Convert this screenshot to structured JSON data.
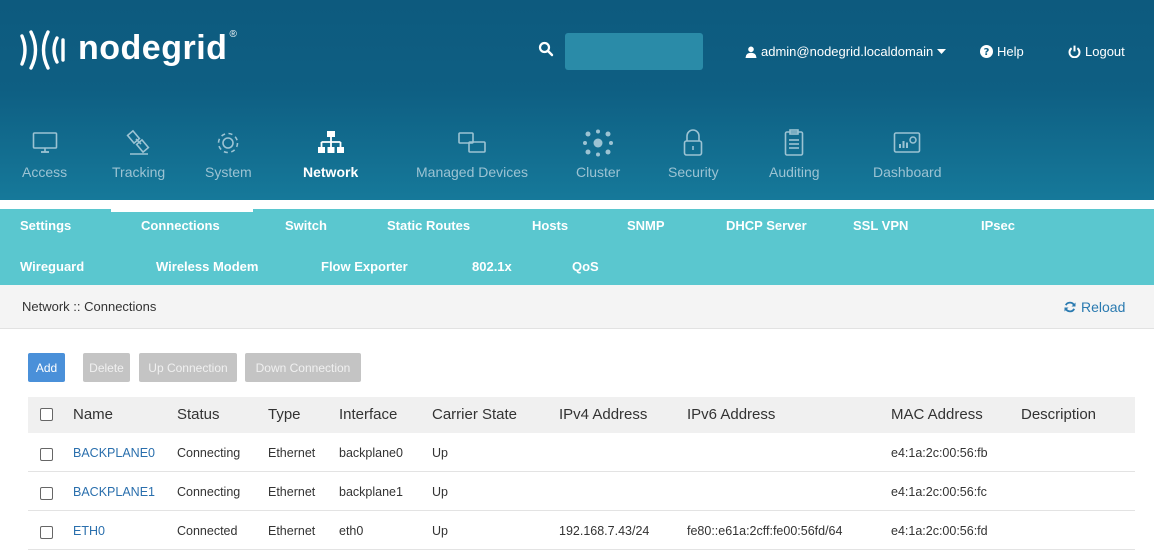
{
  "header": {
    "logo_text": "nodegrid",
    "logo_mark": "®",
    "user": "admin@nodegrid.localdomain",
    "help": "Help",
    "logout": "Logout",
    "search": {
      "value": "",
      "placeholder": ""
    }
  },
  "main_nav": [
    {
      "label": "Access",
      "icon": "monitor-icon"
    },
    {
      "label": "Tracking",
      "icon": "satellite-icon"
    },
    {
      "label": "System",
      "icon": "gear-icon"
    },
    {
      "label": "Network",
      "icon": "network-icon",
      "active": true
    },
    {
      "label": "Managed Devices",
      "icon": "devices-icon"
    },
    {
      "label": "Cluster",
      "icon": "cluster-icon"
    },
    {
      "label": "Security",
      "icon": "lock-icon"
    },
    {
      "label": "Auditing",
      "icon": "clipboard-icon"
    },
    {
      "label": "Dashboard",
      "icon": "dashboard-icon"
    }
  ],
  "sub_nav": [
    "Settings",
    "Connections",
    "Switch",
    "Static Routes",
    "Hosts",
    "SNMP",
    "DHCP Server",
    "SSL VPN",
    "IPsec",
    "Wireguard",
    "Wireless Modem",
    "Flow Exporter",
    "802.1x",
    "QoS"
  ],
  "sub_nav_active": "Connections",
  "breadcrumb": "Network :: Connections",
  "reload": "Reload",
  "buttons": {
    "add": "Add",
    "delete": "Delete",
    "up": "Up Connection",
    "down": "Down Connection"
  },
  "table": {
    "columns": [
      "Name",
      "Status",
      "Type",
      "Interface",
      "Carrier State",
      "IPv4 Address",
      "IPv6 Address",
      "MAC Address",
      "Description"
    ],
    "rows": [
      {
        "name": "BACKPLANE0",
        "status": "Connecting",
        "type": "Ethernet",
        "interface": "backplane0",
        "carrier": "Up",
        "ipv4": "",
        "ipv6": "",
        "mac": "e4:1a:2c:00:56:fb",
        "description": ""
      },
      {
        "name": "BACKPLANE1",
        "status": "Connecting",
        "type": "Ethernet",
        "interface": "backplane1",
        "carrier": "Up",
        "ipv4": "",
        "ipv6": "",
        "mac": "e4:1a:2c:00:56:fc",
        "description": ""
      },
      {
        "name": "ETH0",
        "status": "Connected",
        "type": "Ethernet",
        "interface": "eth0",
        "carrier": "Up",
        "ipv4": "192.168.7.43/24",
        "ipv6": "fe80::e61a:2cff:fe00:56fd/64",
        "mac": "e4:1a:2c:00:56:fd",
        "description": ""
      }
    ]
  },
  "colors": {
    "header": "#0e5f83",
    "subnav": "#5ac7cf",
    "primary": "#4a90d9",
    "link": "#2a6fad"
  }
}
